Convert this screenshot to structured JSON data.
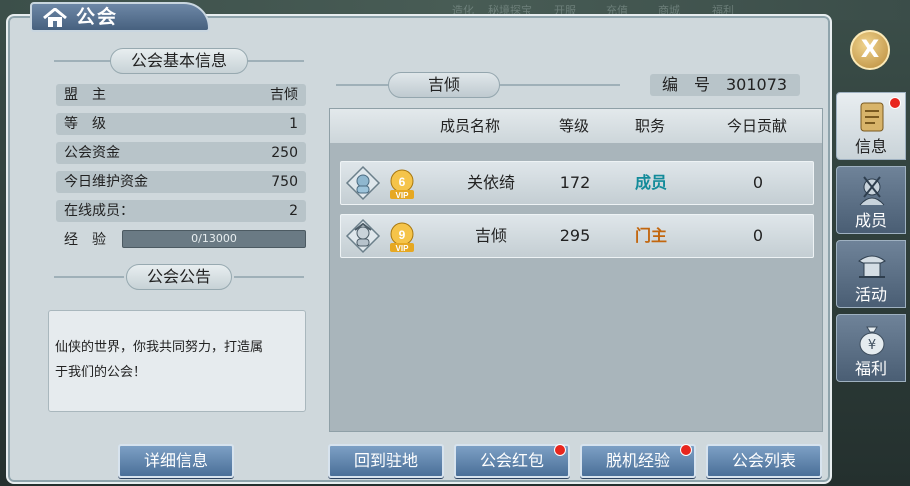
{
  "window": {
    "title": "公会"
  },
  "top_ghost_text": [
    "造化",
    "秘境探宝",
    "开服",
    "充值",
    "商城",
    "福利"
  ],
  "basic_info": {
    "section_title": "公会基本信息",
    "rows": [
      {
        "label": "盟　主",
        "value": "吉倾"
      },
      {
        "label": "等　级",
        "value": "1"
      },
      {
        "label": "公会资金",
        "value": "250"
      },
      {
        "label": "今日维护资金",
        "value": "750"
      },
      {
        "label": "在线成员：",
        "value": "2"
      }
    ],
    "exp": {
      "label": "经　验",
      "text": "0/13000",
      "fraction": 0.0
    }
  },
  "announcement": {
    "section_title": "公会公告",
    "text_line1": "仙侠的世界，你我共同努力，打造属",
    "text_line2": "于我们的公会！"
  },
  "buttons": {
    "detail": "详细信息",
    "back_to_base": "回到驻地",
    "guild_red_packet": "公会红包",
    "offline_exp": "脱机经验",
    "guild_list": "公会列表"
  },
  "guild": {
    "name": "吉倾",
    "id_label": "编　号",
    "id_value": "301073"
  },
  "member_table": {
    "headers": {
      "name": "成员名称",
      "level": "等级",
      "role": "职务",
      "today_contribution": "今日贡献"
    },
    "rows": [
      {
        "vip": "6",
        "vip_tag": "VIP",
        "name": "关依绮",
        "level": "172",
        "role": "成员",
        "contribution": "0"
      },
      {
        "vip": "9",
        "vip_tag": "VIP",
        "name": "吉倾",
        "level": "295",
        "role": "门主",
        "contribution": "0"
      }
    ]
  },
  "side_tabs": [
    {
      "label": "信息",
      "active": true,
      "icon": "scroll-icon",
      "badge": true
    },
    {
      "label": "成员",
      "active": false,
      "icon": "members-icon",
      "badge": false
    },
    {
      "label": "活动",
      "active": false,
      "icon": "activity-icon",
      "badge": false
    },
    {
      "label": "福利",
      "active": false,
      "icon": "money-bag-icon",
      "badge": false
    }
  ],
  "close_label": "X",
  "colors": {
    "member_role": "#128b9a",
    "leader_role": "#c2660e",
    "badge": "#e8261e",
    "button": "#5d82ad"
  }
}
